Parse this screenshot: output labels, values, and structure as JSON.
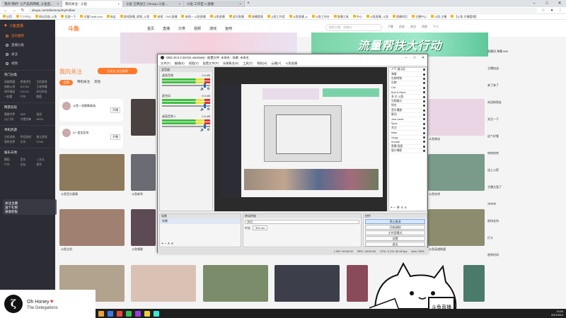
{
  "browser": {
    "tabs": [
      {
        "label": "我的“我的” 之产品的网络_斗鱼直播 ...",
        "active": false
      },
      {
        "label": "我的关注 - 斗鱼",
        "active": true
      },
      {
        "label": "斗鱼 王牌战士 | Douyu 斗鱼 ...",
        "active": false
      },
      {
        "label": "斗鱼 工作室 A 直播",
        "active": false
      }
    ],
    "url": "douyu.com/directory/myFollow",
    "bookmarks": [
      "应用",
      "个人中心",
      "网站导航-斗鱼",
      "百度一下",
      "天猫Tmall.com",
      "淘宝",
      "游戏直播_视频_斗鱼",
      "电视 - TMC直播",
      "电视一-斗鱼直播",
      "斗鱼直播",
      "虎牙直播",
      "录播管理",
      "斗鱼工作室",
      "斗鱼直播_A",
      "斗鱼工作台",
      "直播工具",
      "中心",
      "斗鱼直播_斗鱼",
      "直播伴侣",
      "主播中心",
      "斗鱼-主播",
      "【斗鱼-开播管理】"
    ]
  },
  "douyu": {
    "sidebar": {
      "brand": "斗鱼直播",
      "menu": [
        "首页推荐",
        "直播分类",
        "关注",
        "视频"
      ],
      "sections": [
        {
          "title": "热门分类",
          "tags": [
            "英雄联盟",
            "绝地求生",
            "主机游戏",
            "穿越火线",
            "DOTA2",
            "王者荣耀",
            "和平精英",
            "CS:GO",
            "炉石传说",
            "一起看",
            "户外",
            "颜值"
          ]
        },
        {
          "title": "网游竞技",
          "tags": [
            "魔兽世界",
            "DNF",
            "逆战",
            "QQ飞车",
            "守望先锋",
            "APEX"
          ]
        },
        {
          "title": "单机热游",
          "tags": [
            "主机游戏",
            "怀旧游戏",
            "独立游戏",
            "我的世界",
            "方舟",
            "GTA5"
          ]
        },
        {
          "title": "娱乐天地",
          "tags": [
            "舞蹈",
            "音乐",
            "二次元",
            "户外",
            "交友",
            "星秀"
          ]
        }
      ]
    },
    "topnav": [
      "首页",
      "直播",
      "分类",
      "视频",
      "游戏",
      "鱼吧"
    ],
    "logo": "斗鱼",
    "search_placeholder": "搜索主播、直播间",
    "top_icons": [
      "下载",
      "历史",
      "关注",
      "消息",
      "个人"
    ],
    "banner_text": "流量帮扶大行动",
    "follow_title": "我的关注",
    "follow_button": "已关注  关注推荐",
    "follow_tabs": [
      "全部",
      "特别关注",
      "其他"
    ],
    "anchors": [
      {
        "name": "斗鱼一双眼睛真诚",
        "status": "开播"
      },
      {
        "name": "D!~爱笑女孩",
        "status": "开播"
      }
    ],
    "thumb_labels": [
      "斗鱼官方赛事",
      "斗鱼新秀",
      "斗鱼夜谈",
      "斗鱼吃鸡",
      "斗鱼英雄联盟",
      "斗鱼主机",
      "斗鱼唱歌",
      "斗鱼颜值",
      "斗鱼户外",
      "斗鱼王者"
    ],
    "chat": [
      "直播间 弹幕 666",
      "主播加油",
      "来了来了",
      "欢迎新朋友",
      "关注一下",
      "这个好看",
      "哈哈哈哈",
      "送上火箭",
      "主播太强了",
      "冲冲冲",
      "前排支持",
      "打卡",
      "夜宵时间"
    ],
    "overlay_lines": [
      "关注主播",
      "送个礼物",
      "谢谢老板"
    ]
  },
  "obs": {
    "title": "OBS 26.0.2 (64-bit, windows) - 配置文件: 未命名 - 场景: 未命名",
    "menu": [
      "文件(F)",
      "编辑(E)",
      "视图(V)",
      "配置文件(P)",
      "场景集合(S)",
      "工具(T)",
      "帮助(H)",
      "云播(Y)",
      "斗鱼直播"
    ],
    "mixer_title": "混音器",
    "mixer": [
      {
        "name": "桌面音频",
        "db": "0.0 dB"
      },
      {
        "name": "麦克风",
        "db": "0.0 dB"
      },
      {
        "name": "桌面音频 2",
        "db": "0.0 dB"
      }
    ],
    "sources": [
      "人气 展示区",
      "弹幕",
      "礼物特效",
      "礼物",
      "Cat",
      "Bub & Rand",
      "多 白 斗鱼",
      "礼物展示",
      "排名",
      "音乐播放",
      "歌词",
      "Just Lamb",
      "Spec",
      "关注",
      "Main",
      "Vlogs",
      "Arcade",
      "直播 画面",
      "窗口捕获"
    ],
    "scenes_title": "场景",
    "scenes": [
      "场景"
    ],
    "transition_title": "转场特效",
    "transition_value": "淡出",
    "duration_label": "时长",
    "duration_value": "300 ms",
    "controls_title": "控件",
    "controls": [
      {
        "label": "停止推流",
        "highlight": true
      },
      {
        "label": "开始录制",
        "highlight": false
      },
      {
        "label": "工作室模式",
        "highlight": false
      },
      {
        "label": "设置",
        "highlight": false
      },
      {
        "label": "退出",
        "highlight": false
      }
    ],
    "status": [
      "LIVE: 00:00:00",
      "REC: 00:00:00",
      "CPU: 3.1%, 60.00 fps",
      "kb/s: 2501"
    ]
  },
  "now_playing": {
    "logo": "ζ",
    "title": "Oh Honey",
    "artist": "The Delegations"
  },
  "cat_sign": "斗鱼直播",
  "taskbar": {
    "time": "10:00",
    "date": "2021/8/14"
  },
  "colors": {
    "accent": "#ff7a2b",
    "sidebar": "#2c2c34",
    "banner": "#7ad3a8"
  }
}
